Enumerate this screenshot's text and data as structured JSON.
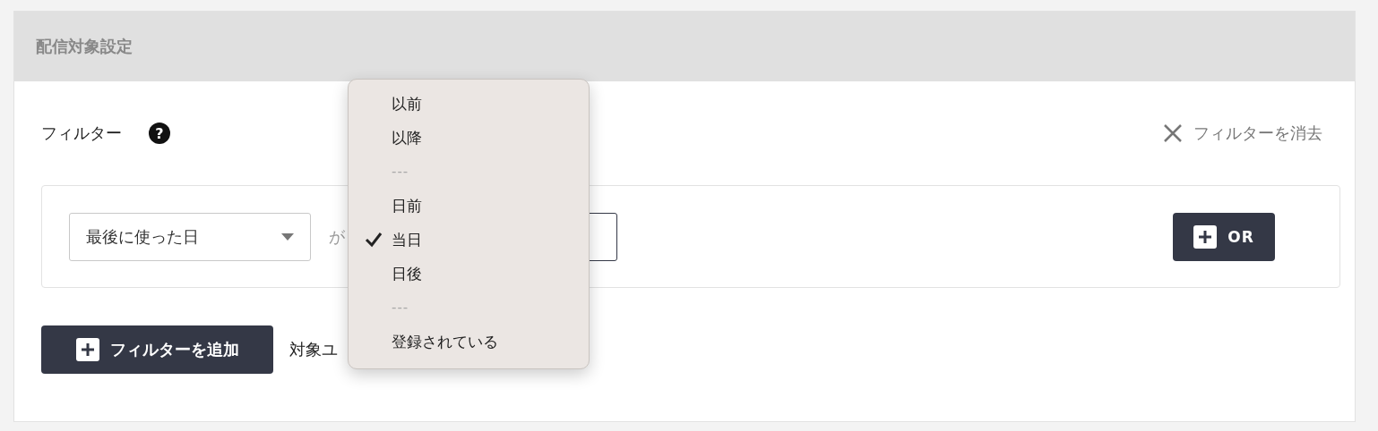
{
  "panel": {
    "title": "配信対象設定"
  },
  "filter_header": {
    "label": "フィルター",
    "help": "?",
    "clear_label": "フィルターを消去"
  },
  "condition": {
    "field_select": "最後に使った日",
    "particle": "が",
    "or_button": "OR"
  },
  "add_filter_button": "フィルターを追加",
  "target_label": "対象ユ",
  "dropdown": {
    "options": [
      {
        "kind": "option",
        "label": "以前",
        "selected": false
      },
      {
        "kind": "option",
        "label": "以降",
        "selected": false
      },
      {
        "kind": "separator",
        "label": "---"
      },
      {
        "kind": "option",
        "label": "日前",
        "selected": false
      },
      {
        "kind": "option",
        "label": "当日",
        "selected": true
      },
      {
        "kind": "option",
        "label": "日後",
        "selected": false
      },
      {
        "kind": "separator",
        "label": "---"
      },
      {
        "kind": "option",
        "label": "登録されている",
        "selected": false
      }
    ]
  }
}
